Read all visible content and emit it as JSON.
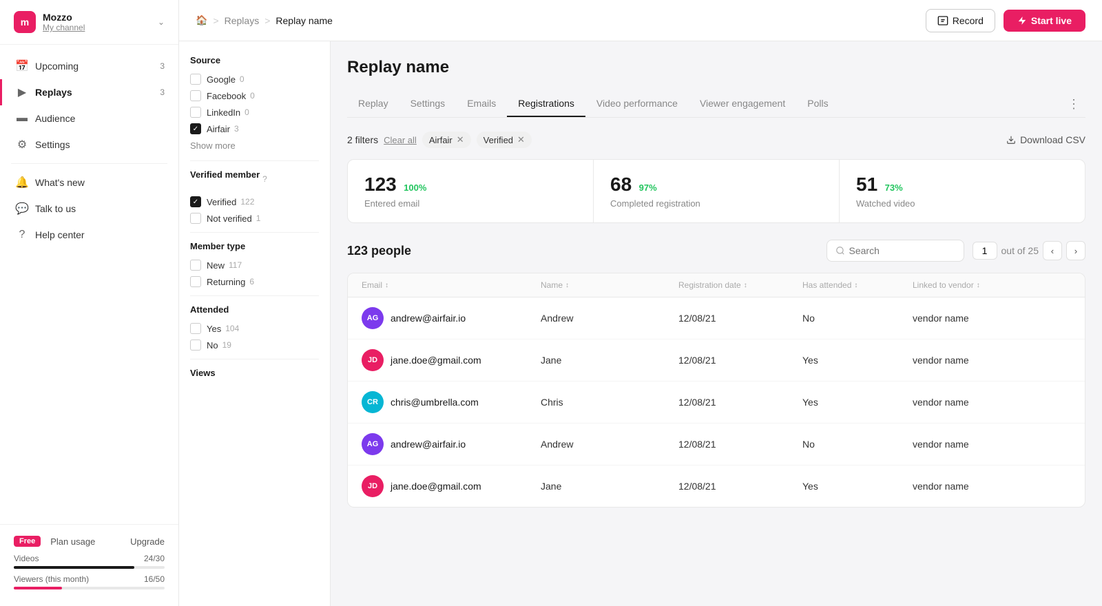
{
  "sidebar": {
    "logo_letter": "m",
    "brand_name": "Mozzo",
    "channel": "My channel",
    "nav_items": [
      {
        "id": "upcoming",
        "label": "Upcoming",
        "badge": "3",
        "icon": "calendar"
      },
      {
        "id": "replays",
        "label": "Replays",
        "badge": "3",
        "icon": "play-circle",
        "active": true
      },
      {
        "id": "audience",
        "label": "Audience",
        "badge": "",
        "icon": "bar-chart"
      },
      {
        "id": "settings",
        "label": "Settings",
        "badge": "",
        "icon": "settings"
      }
    ],
    "secondary_items": [
      {
        "id": "whats-new",
        "label": "What's new",
        "icon": "bell"
      },
      {
        "id": "talk-to-us",
        "label": "Talk to us",
        "icon": "message-circle"
      },
      {
        "id": "help-center",
        "label": "Help center",
        "icon": "help-circle"
      }
    ],
    "plan": {
      "badge": "Free",
      "label": "Plan usage",
      "upgrade": "Upgrade",
      "videos_label": "Videos",
      "videos_value": "24/30",
      "videos_pct": 80,
      "viewers_label": "Viewers (this month)",
      "viewers_value": "16/50",
      "viewers_pct": 32
    }
  },
  "topbar": {
    "breadcrumb_home": "🏠",
    "breadcrumb_replays": "Replays",
    "breadcrumb_current": "Replay name",
    "record_label": "Record",
    "start_live_label": "Start live"
  },
  "page": {
    "title": "Replay name"
  },
  "tabs": [
    {
      "id": "replay",
      "label": "Replay"
    },
    {
      "id": "settings",
      "label": "Settings"
    },
    {
      "id": "emails",
      "label": "Emails"
    },
    {
      "id": "registrations",
      "label": "Registrations",
      "active": true
    },
    {
      "id": "video-performance",
      "label": "Video performance"
    },
    {
      "id": "viewer-engagement",
      "label": "Viewer engagement"
    },
    {
      "id": "polls",
      "label": "Polls"
    }
  ],
  "filters": {
    "count": "2 filters",
    "clear_all": "Clear all",
    "chips": [
      {
        "label": "Airfair"
      },
      {
        "label": "Verified"
      }
    ],
    "download_csv": "Download CSV"
  },
  "stats": [
    {
      "number": "123",
      "pct": "100%",
      "label": "Entered email"
    },
    {
      "number": "68",
      "pct": "97%",
      "label": "Completed registration"
    },
    {
      "number": "51",
      "pct": "73%",
      "label": "Watched video"
    }
  ],
  "people": {
    "title": "123 people",
    "search_placeholder": "Search",
    "page_current": "1",
    "page_total": "out of 25"
  },
  "table": {
    "columns": [
      {
        "label": "Email",
        "sortable": true
      },
      {
        "label": "Name",
        "sortable": true
      },
      {
        "label": "Registration date",
        "sortable": true
      },
      {
        "label": "Has attended",
        "sortable": true
      },
      {
        "label": "Linked to vendor",
        "sortable": true
      }
    ],
    "rows": [
      {
        "id": 1,
        "avatar_initials": "AG",
        "avatar_color": "#7c3aed",
        "email": "andrew@airfair.io",
        "name": "Andrew",
        "reg_date": "12/08/21",
        "attended": "No",
        "vendor": "vendor name"
      },
      {
        "id": 2,
        "avatar_initials": "JD",
        "avatar_color": "#e91e63",
        "email": "jane.doe@gmail.com",
        "name": "Jane",
        "reg_date": "12/08/21",
        "attended": "Yes",
        "vendor": "vendor name"
      },
      {
        "id": 3,
        "avatar_initials": "CR",
        "avatar_color": "#06b6d4",
        "email": "chris@umbrella.com",
        "name": "Chris",
        "reg_date": "12/08/21",
        "attended": "Yes",
        "vendor": "vendor name"
      },
      {
        "id": 4,
        "avatar_initials": "AG",
        "avatar_color": "#7c3aed",
        "email": "andrew@airfair.io",
        "name": "Andrew",
        "reg_date": "12/08/21",
        "attended": "No",
        "vendor": "vendor name"
      },
      {
        "id": 5,
        "avatar_initials": "JD",
        "avatar_color": "#e91e63",
        "email": "jane.doe@gmail.com",
        "name": "Jane",
        "reg_date": "12/08/21",
        "attended": "Yes",
        "vendor": "vendor name"
      }
    ]
  },
  "filter_panel": {
    "source_title": "Source",
    "source_options": [
      {
        "label": "Google",
        "count": "0",
        "checked": false
      },
      {
        "label": "Facebook",
        "count": "0",
        "checked": false
      },
      {
        "label": "LinkedIn",
        "count": "0",
        "checked": false
      },
      {
        "label": "Airfair",
        "count": "3",
        "checked": true
      }
    ],
    "show_more": "Show more",
    "verified_title": "Verified member",
    "verified_options": [
      {
        "label": "Verified",
        "count": "122",
        "checked": true
      },
      {
        "label": "Not verified",
        "count": "1",
        "checked": false
      }
    ],
    "member_type_title": "Member type",
    "member_type_options": [
      {
        "label": "New",
        "count": "117",
        "checked": false
      },
      {
        "label": "Returning",
        "count": "6",
        "checked": false
      }
    ],
    "attended_title": "Attended",
    "attended_options": [
      {
        "label": "Yes",
        "count": "104",
        "checked": false
      },
      {
        "label": "No",
        "count": "19",
        "checked": false
      }
    ],
    "views_title": "Views"
  }
}
